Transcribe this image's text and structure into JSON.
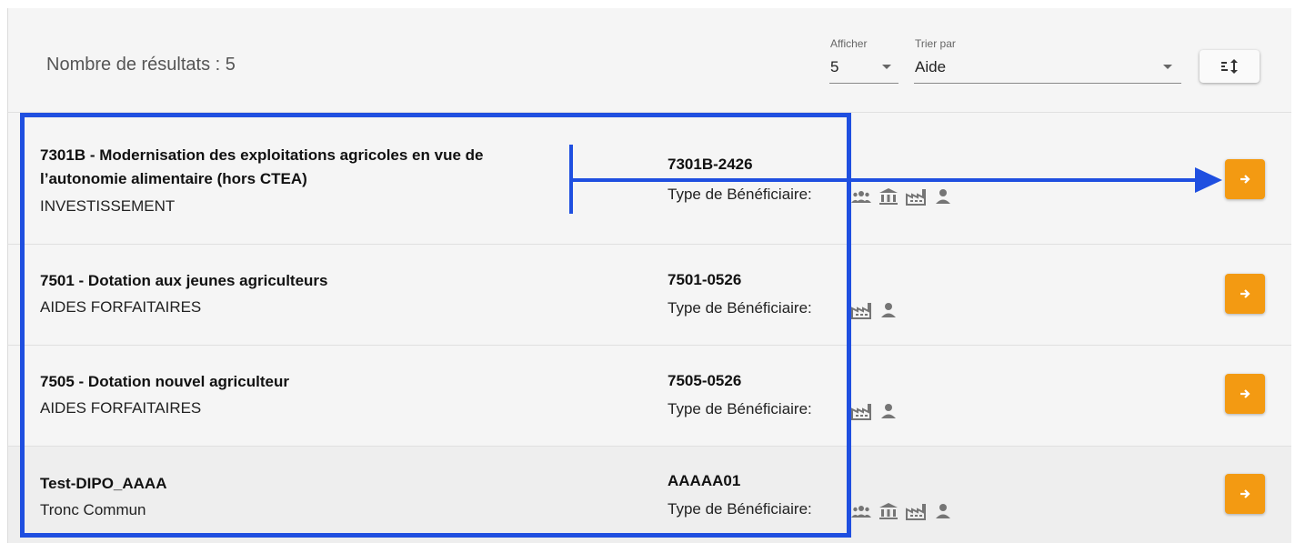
{
  "header": {
    "results_label": "Nombre de résultats : 5",
    "afficher": {
      "label": "Afficher",
      "value": "5"
    },
    "trier_par": {
      "label": "Trier par",
      "value": "Aide"
    },
    "sort_icon": "sort-direction-icon"
  },
  "rows": [
    {
      "title_line1": "7301B - Modernisation des exploitations agricoles en vue de",
      "title_line2": "l’autonomie alimentaire (hors CTEA)",
      "subtitle": "INVESTISSEMENT",
      "code": "7301B-2426",
      "benef_label": "Type de Bénéficiaire:",
      "icons": [
        "group-icon",
        "institution-icon",
        "factory-icon",
        "person-icon"
      ]
    },
    {
      "title_line1": "7501 - Dotation aux jeunes agriculteurs",
      "subtitle": "AIDES FORFAITAIRES",
      "code": "7501-0526",
      "benef_label": "Type de Bénéficiaire:",
      "icons": [
        "factory-icon",
        "person-icon"
      ]
    },
    {
      "title_line1": "7505 - Dotation nouvel agriculteur",
      "subtitle": "AIDES FORFAITAIRES",
      "code": "7505-0526",
      "benef_label": "Type de Bénéficiaire:",
      "icons": [
        "factory-icon",
        "person-icon"
      ]
    },
    {
      "title_line1": "Test-DIPO_AAAA",
      "subtitle": "Tronc Commun",
      "code": "AAAAA01",
      "benef_label": "Type de Bénéficiaire:",
      "icons": [
        "group-icon",
        "institution-icon",
        "factory-icon",
        "person-icon"
      ]
    }
  ],
  "colors": {
    "accent": "#f39a12",
    "annotation": "#1f4fe0",
    "icon_gray": "#757575"
  }
}
